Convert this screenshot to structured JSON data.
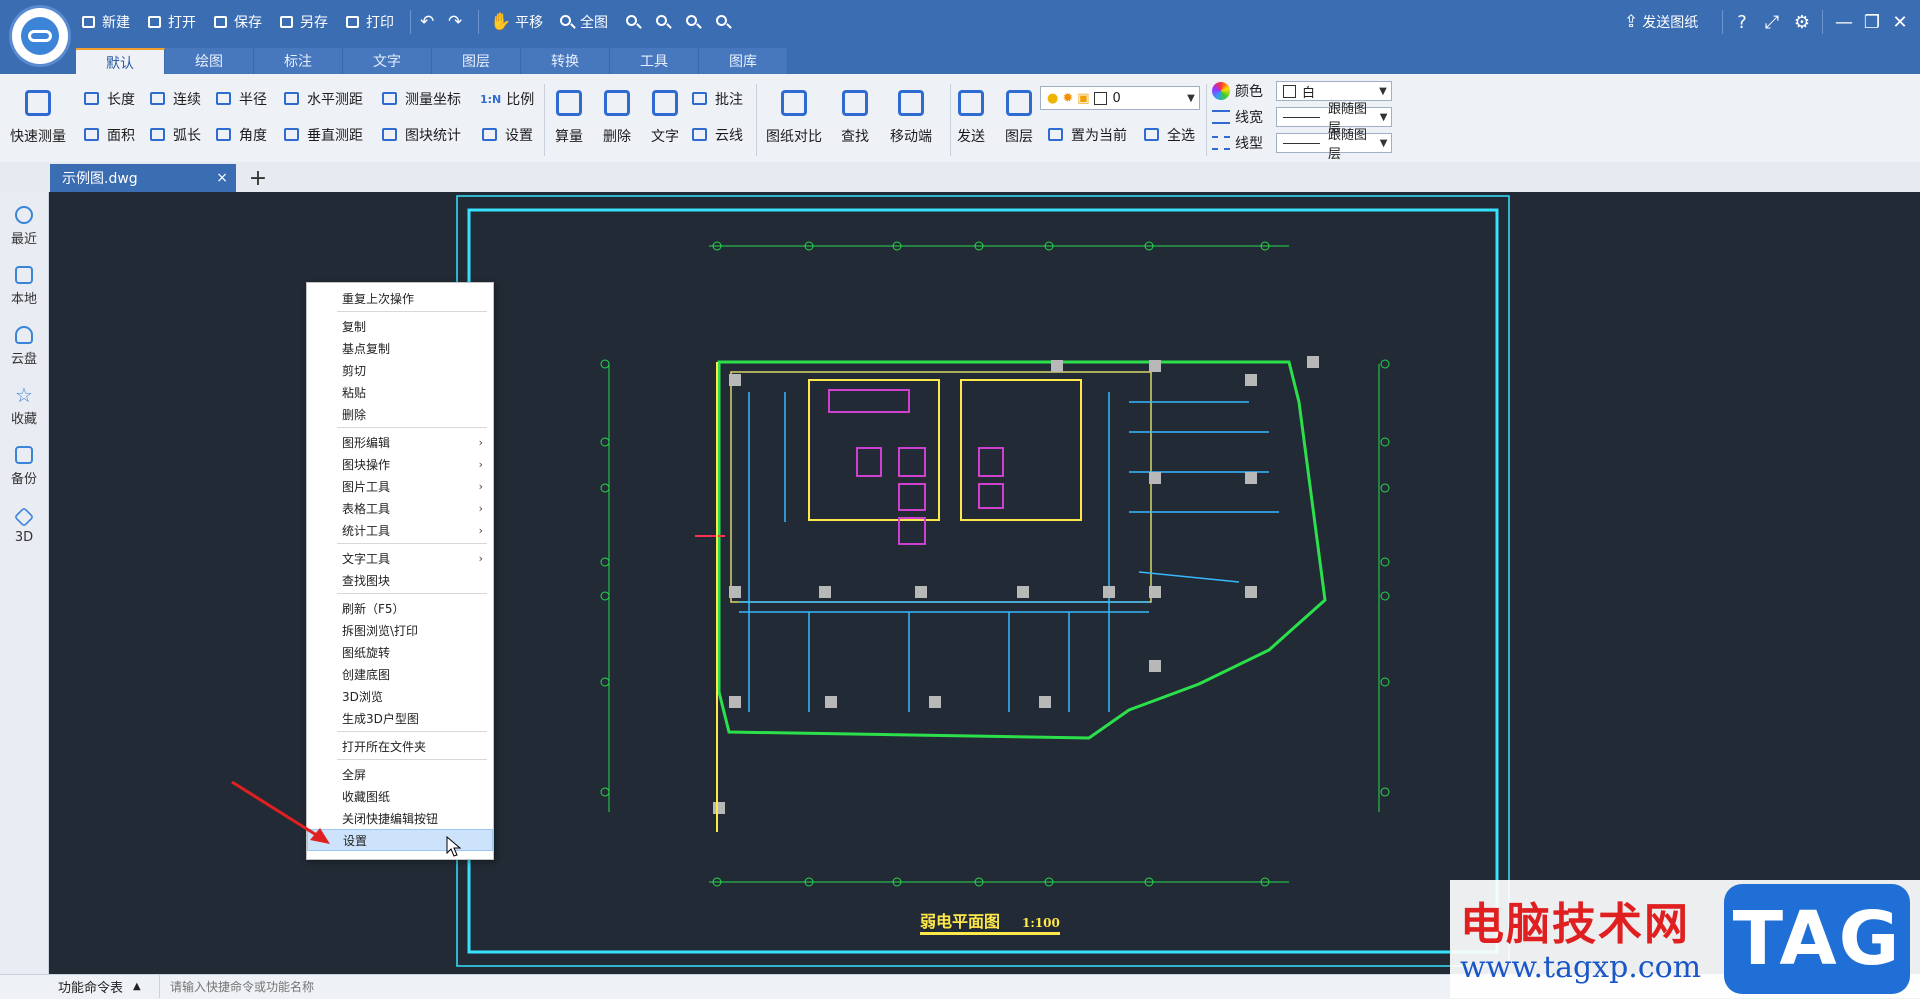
{
  "app": {
    "quick": {
      "new": "新建",
      "open": "打开",
      "save": "保存",
      "save_as": "另存",
      "print": "打印",
      "pan": "平移",
      "fit": "全图",
      "send": "发送图纸"
    }
  },
  "tabs": [
    "默认",
    "绘图",
    "标注",
    "文字",
    "图层",
    "转换",
    "工具",
    "图库"
  ],
  "ribbon": {
    "quick_measure": "快速测量",
    "length": "长度",
    "area": "面积",
    "continuous": "连续",
    "arc_length": "弧长",
    "radius": "半径",
    "angle": "角度",
    "h_measure": "水平测距",
    "v_measure": "垂直测距",
    "measure_coord": "测量坐标",
    "block_stats": "图块统计",
    "scale_ico": "1:N",
    "scale": "比例",
    "settings": "设置",
    "calc": "算量",
    "delete": "删除",
    "text": "文字",
    "annotate": "批注",
    "cloud": "云线",
    "compare": "图纸对比",
    "find": "查找",
    "mobile": "移动端",
    "send": "发送",
    "layer": "图层",
    "set_current": "置为当前",
    "select_all": "全选",
    "layer_value": "0",
    "color_label": "颜色",
    "color_value": "白",
    "linewidth_label": "线宽",
    "linewidth_value": "跟随图层",
    "linetype_label": "线型",
    "linetype_value": "跟随图层"
  },
  "doc_tab": {
    "name": "示例图.dwg",
    "close": "×",
    "add": "+"
  },
  "sidebar": [
    "最近",
    "本地",
    "云盘",
    "收藏",
    "备份",
    "3D"
  ],
  "context_menu": [
    {
      "label": "重复上次操作"
    },
    {
      "sep": true
    },
    {
      "label": "复制"
    },
    {
      "label": "基点复制"
    },
    {
      "label": "剪切"
    },
    {
      "label": "粘贴"
    },
    {
      "label": "删除"
    },
    {
      "sep": true
    },
    {
      "label": "图形编辑",
      "sub": true
    },
    {
      "label": "图块操作",
      "sub": true
    },
    {
      "label": "图片工具",
      "sub": true
    },
    {
      "label": "表格工具",
      "sub": true
    },
    {
      "label": "统计工具",
      "sub": true
    },
    {
      "sep": true
    },
    {
      "label": "文字工具",
      "sub": true
    },
    {
      "label": "查找图块"
    },
    {
      "sep": true
    },
    {
      "label": "刷新（F5）"
    },
    {
      "label": "拆图浏览\\打印"
    },
    {
      "label": "图纸旋转"
    },
    {
      "label": "创建底图"
    },
    {
      "label": "3D浏览"
    },
    {
      "label": "生成3D户型图"
    },
    {
      "sep": true
    },
    {
      "label": "打开所在文件夹"
    },
    {
      "sep": true
    },
    {
      "label": "全屏"
    },
    {
      "label": "收藏图纸"
    },
    {
      "label": "关闭快捷编辑按钮"
    },
    {
      "label": "设置",
      "highlight": true
    }
  ],
  "drawing": {
    "title": "弱电平面图",
    "scale": "1:100"
  },
  "status": {
    "cmd_tab": "功能命令表",
    "input_placeholder": "请输入快捷命令或功能名称"
  },
  "watermark": {
    "title": "电脑技术网",
    "url": "www.tagxp.com",
    "tag": "TAG"
  }
}
